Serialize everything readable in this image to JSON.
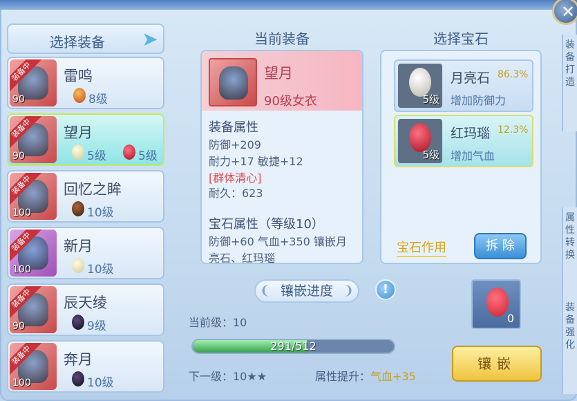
{
  "close_icon": "close-icon",
  "side_tabs": [
    {
      "text": "装备打造"
    },
    {
      "text": "属性转换"
    },
    {
      "text": "装备强化"
    }
  ],
  "left": {
    "title": "选择装备",
    "items": [
      {
        "name": "雷鸣",
        "level": "90",
        "ribbon": "装备中",
        "gems": [
          {
            "color": "#e07030",
            "text": "8级"
          }
        ]
      },
      {
        "name": "望月",
        "level": "90",
        "ribbon": "装备中",
        "gems": [
          {
            "color": "#e8e6c8",
            "text": "5级"
          },
          {
            "color": "#d02030",
            "text": "5级"
          }
        ],
        "selected": true
      },
      {
        "name": "回忆之眸",
        "level": "100",
        "ribbon": "装备中",
        "gems": [
          {
            "color": "#6a3a1a",
            "text": "10级"
          }
        ]
      },
      {
        "name": "新月",
        "level": "100",
        "ribbon": "装备中",
        "gems": [
          {
            "color": "#e8e6c8",
            "text": "10级"
          }
        ]
      },
      {
        "name": "辰天绫",
        "level": "90",
        "ribbon": "装备中",
        "gems": [
          {
            "color": "#2a1f3a",
            "text": "9级"
          }
        ]
      },
      {
        "name": "奔月",
        "level": "100",
        "ribbon": "装备中",
        "gems": [
          {
            "color": "#2a1f3a",
            "text": "10级"
          }
        ]
      }
    ]
  },
  "middle": {
    "title": "当前装备",
    "name": "望月",
    "type": "90级女衣",
    "attr_heading": "装备属性",
    "lines": [
      "防御+209",
      "耐力+17 敏捷+12"
    ],
    "special": "[群体清心]",
    "durability": "耐久：623",
    "gem_heading": "宝石属性（等级10）",
    "gem_line1": "防御+60 气血+350 镶嵌月",
    "gem_line2": "亮石、红玛瑙"
  },
  "right": {
    "title": "选择宝石",
    "gems": [
      {
        "name": "月亮石",
        "pct": "86.3%",
        "desc": "增加防御力",
        "level": "5级",
        "color": "#e8e6e0"
      },
      {
        "name": "红玛瑙",
        "pct": "12.3%",
        "desc": "增加气血",
        "level": "5级",
        "color": "#d02030",
        "selected": true
      }
    ],
    "effect_label": "宝石作用",
    "remove_label": "拆 除"
  },
  "progress": {
    "label": "镶嵌进度",
    "info": "!",
    "current_level": "当前级：10",
    "value_text": "291/512",
    "fraction": 0.568,
    "next_level": "下一级：10★★",
    "attr_label": "属性提升：",
    "attr_value": "气血+35"
  },
  "slot": {
    "count": "0",
    "color": "#d02030"
  },
  "inlay_button": "镶嵌"
}
